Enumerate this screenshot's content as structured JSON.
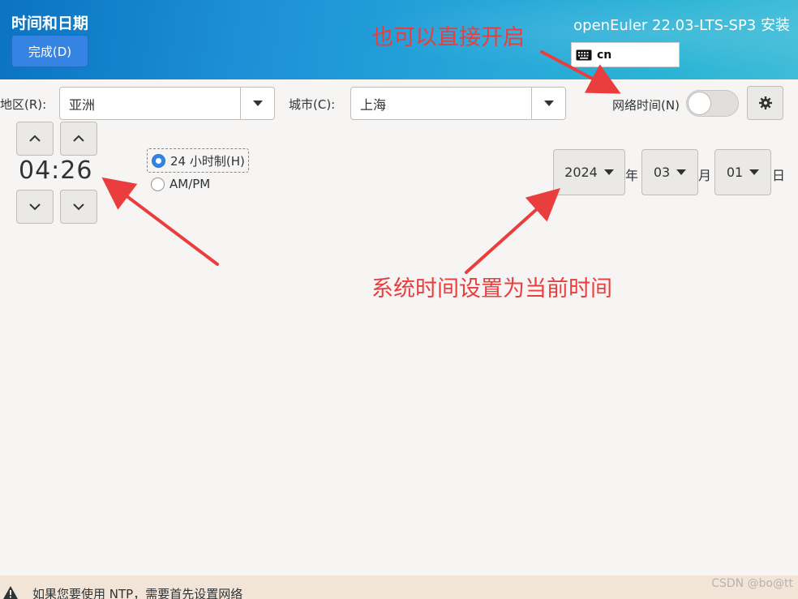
{
  "header": {
    "title": "时间和日期",
    "done_label": "完成(D)",
    "product": "openEuler 22.03-LTS-SP3 安装",
    "keyboard_layout": "cn"
  },
  "region": {
    "label": "地区(R):",
    "value": "亚洲"
  },
  "city": {
    "label": "城市(C):",
    "value": "上海"
  },
  "network_time": {
    "label": "网络时间(N)",
    "enabled": false
  },
  "time": {
    "display": "04:26",
    "hours": "04",
    "minutes": "26"
  },
  "format": {
    "option_24h": "24 小时制(H)",
    "option_ampm": "AM/PM",
    "selected": "24h"
  },
  "date": {
    "year": "2024",
    "year_unit": "年",
    "month": "03",
    "month_unit": "月",
    "day": "01",
    "day_unit": "日"
  },
  "annotations": {
    "network_hint": "也可以直接开启",
    "time_hint": "系统时间设置为当前时间"
  },
  "warning": {
    "text": "如果您要使用 NTP，需要首先设置网络"
  },
  "watermark": "CSDN @bo@tt",
  "colors": {
    "accent": "#3584e4",
    "annotation": "#ea3e3e",
    "warning_bar": "#f2e4d6"
  }
}
